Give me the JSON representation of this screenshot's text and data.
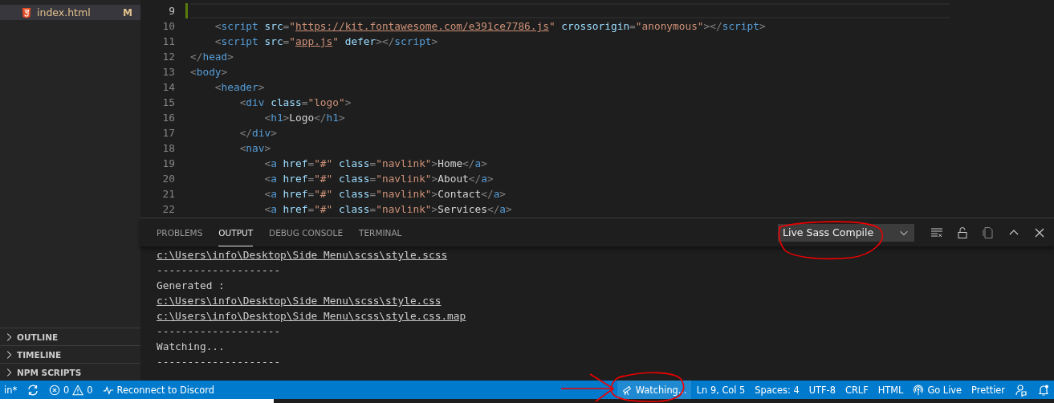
{
  "sidebar": {
    "files": [
      {
        "name": "index.html",
        "badge": "M",
        "selected": true
      }
    ],
    "sections": [
      {
        "label": "OUTLINE",
        "expanded": false
      },
      {
        "label": "TIMELINE",
        "expanded": false
      },
      {
        "label": "NPM SCRIPTS",
        "expanded": false
      }
    ]
  },
  "editor": {
    "lines": [
      {
        "number": "9",
        "current": true,
        "modified": true
      },
      {
        "number": "10",
        "current": false,
        "modified": false,
        "tokens": [
          {
            "kind": "punct",
            "text": "    <"
          },
          {
            "kind": "tag",
            "text": "script"
          },
          {
            "kind": "attr",
            "text": " src"
          },
          {
            "kind": "punct",
            "text": "="
          },
          {
            "kind": "string",
            "text": "\""
          },
          {
            "kind": "link",
            "text": "https://kit.fontawesome.com/e391ce7786.js"
          },
          {
            "kind": "string",
            "text": "\""
          },
          {
            "kind": "attr",
            "text": " crossorigin"
          },
          {
            "kind": "punct",
            "text": "="
          },
          {
            "kind": "string",
            "text": "\"anonymous\""
          },
          {
            "kind": "punct",
            "text": "></"
          },
          {
            "kind": "tag",
            "text": "script"
          },
          {
            "kind": "punct",
            "text": ">"
          }
        ]
      },
      {
        "number": "11",
        "current": false,
        "modified": false,
        "tokens": [
          {
            "kind": "punct",
            "text": "    <"
          },
          {
            "kind": "tag",
            "text": "script"
          },
          {
            "kind": "attr",
            "text": " src"
          },
          {
            "kind": "punct",
            "text": "="
          },
          {
            "kind": "string",
            "text": "\""
          },
          {
            "kind": "link",
            "text": "app.js"
          },
          {
            "kind": "string",
            "text": "\""
          },
          {
            "kind": "attr",
            "text": " defer"
          },
          {
            "kind": "punct",
            "text": "></"
          },
          {
            "kind": "tag",
            "text": "script"
          },
          {
            "kind": "punct",
            "text": ">"
          }
        ]
      },
      {
        "number": "12",
        "current": false,
        "modified": false,
        "tokens": [
          {
            "kind": "punct",
            "text": "</"
          },
          {
            "kind": "tag",
            "text": "head"
          },
          {
            "kind": "punct",
            "text": ">"
          }
        ]
      },
      {
        "number": "13",
        "current": false,
        "modified": false,
        "tokens": [
          {
            "kind": "punct",
            "text": "<"
          },
          {
            "kind": "tag",
            "text": "body"
          },
          {
            "kind": "punct",
            "text": ">"
          }
        ]
      },
      {
        "number": "14",
        "current": false,
        "modified": false,
        "tokens": [
          {
            "kind": "punct",
            "text": "    <"
          },
          {
            "kind": "tag",
            "text": "header"
          },
          {
            "kind": "punct",
            "text": ">"
          }
        ]
      },
      {
        "number": "15",
        "current": false,
        "modified": false,
        "tokens": [
          {
            "kind": "punct",
            "text": "        <"
          },
          {
            "kind": "tag",
            "text": "div"
          },
          {
            "kind": "attr",
            "text": " class"
          },
          {
            "kind": "punct",
            "text": "="
          },
          {
            "kind": "string",
            "text": "\"logo\""
          },
          {
            "kind": "punct",
            "text": ">"
          }
        ]
      },
      {
        "number": "16",
        "current": false,
        "modified": false,
        "tokens": [
          {
            "kind": "punct",
            "text": "            <"
          },
          {
            "kind": "tag",
            "text": "h1"
          },
          {
            "kind": "punct",
            "text": ">"
          },
          {
            "kind": "text",
            "text": "Logo"
          },
          {
            "kind": "punct",
            "text": "</"
          },
          {
            "kind": "tag",
            "text": "h1"
          },
          {
            "kind": "punct",
            "text": ">"
          }
        ]
      },
      {
        "number": "17",
        "current": false,
        "modified": false,
        "tokens": [
          {
            "kind": "punct",
            "text": "        </"
          },
          {
            "kind": "tag",
            "text": "div"
          },
          {
            "kind": "punct",
            "text": ">"
          }
        ]
      },
      {
        "number": "18",
        "current": false,
        "modified": false,
        "tokens": [
          {
            "kind": "punct",
            "text": "        <"
          },
          {
            "kind": "tag",
            "text": "nav"
          },
          {
            "kind": "punct",
            "text": ">"
          }
        ]
      },
      {
        "number": "19",
        "current": false,
        "modified": false,
        "tokens": [
          {
            "kind": "punct",
            "text": "            <"
          },
          {
            "kind": "tag",
            "text": "a"
          },
          {
            "kind": "attr",
            "text": " href"
          },
          {
            "kind": "punct",
            "text": "="
          },
          {
            "kind": "string",
            "text": "\"#\""
          },
          {
            "kind": "attr",
            "text": " class"
          },
          {
            "kind": "punct",
            "text": "="
          },
          {
            "kind": "string",
            "text": "\"navlink\""
          },
          {
            "kind": "punct",
            "text": ">"
          },
          {
            "kind": "text",
            "text": "Home"
          },
          {
            "kind": "punct",
            "text": "</"
          },
          {
            "kind": "tag",
            "text": "a"
          },
          {
            "kind": "punct",
            "text": ">"
          }
        ]
      },
      {
        "number": "20",
        "current": false,
        "modified": false,
        "tokens": [
          {
            "kind": "punct",
            "text": "            <"
          },
          {
            "kind": "tag",
            "text": "a"
          },
          {
            "kind": "attr",
            "text": " href"
          },
          {
            "kind": "punct",
            "text": "="
          },
          {
            "kind": "string",
            "text": "\"#\""
          },
          {
            "kind": "attr",
            "text": " class"
          },
          {
            "kind": "punct",
            "text": "="
          },
          {
            "kind": "string",
            "text": "\"navlink\""
          },
          {
            "kind": "punct",
            "text": ">"
          },
          {
            "kind": "text",
            "text": "About"
          },
          {
            "kind": "punct",
            "text": "</"
          },
          {
            "kind": "tag",
            "text": "a"
          },
          {
            "kind": "punct",
            "text": ">"
          }
        ]
      },
      {
        "number": "21",
        "current": false,
        "modified": false,
        "tokens": [
          {
            "kind": "punct",
            "text": "            <"
          },
          {
            "kind": "tag",
            "text": "a"
          },
          {
            "kind": "attr",
            "text": " href"
          },
          {
            "kind": "punct",
            "text": "="
          },
          {
            "kind": "string",
            "text": "\"#\""
          },
          {
            "kind": "attr",
            "text": " class"
          },
          {
            "kind": "punct",
            "text": "="
          },
          {
            "kind": "string",
            "text": "\"navlink\""
          },
          {
            "kind": "punct",
            "text": ">"
          },
          {
            "kind": "text",
            "text": "Contact"
          },
          {
            "kind": "punct",
            "text": "</"
          },
          {
            "kind": "tag",
            "text": "a"
          },
          {
            "kind": "punct",
            "text": ">"
          }
        ]
      },
      {
        "number": "22",
        "current": false,
        "modified": false,
        "tokens": [
          {
            "kind": "punct",
            "text": "            <"
          },
          {
            "kind": "tag",
            "text": "a"
          },
          {
            "kind": "attr",
            "text": " href"
          },
          {
            "kind": "punct",
            "text": "="
          },
          {
            "kind": "string",
            "text": "\"#\""
          },
          {
            "kind": "attr",
            "text": " class"
          },
          {
            "kind": "punct",
            "text": "="
          },
          {
            "kind": "string",
            "text": "\"navlink\""
          },
          {
            "kind": "punct",
            "text": ">"
          },
          {
            "kind": "text",
            "text": "Services"
          },
          {
            "kind": "punct",
            "text": "</"
          },
          {
            "kind": "tag",
            "text": "a"
          },
          {
            "kind": "punct",
            "text": ">"
          }
        ]
      }
    ]
  },
  "panel": {
    "tabs": [
      {
        "label": "PROBLEMS",
        "selected": false
      },
      {
        "label": "OUTPUT",
        "selected": true
      },
      {
        "label": "DEBUG CONSOLE",
        "selected": false
      },
      {
        "label": "TERMINAL",
        "selected": false
      }
    ],
    "channel": "Live Sass Compile",
    "output": [
      {
        "kind": "link",
        "text": "c:\\Users\\info\\Desktop\\Side Menu\\scss\\style.scss"
      },
      {
        "kind": "text",
        "text": "--------------------"
      },
      {
        "kind": "text",
        "text": "Generated :"
      },
      {
        "kind": "link",
        "text": "c:\\Users\\info\\Desktop\\Side Menu\\scss\\style.css"
      },
      {
        "kind": "link",
        "text": "c:\\Users\\info\\Desktop\\Side Menu\\scss\\style.css.map"
      },
      {
        "kind": "text",
        "text": "--------------------"
      },
      {
        "kind": "text",
        "text": "Watching..."
      },
      {
        "kind": "text",
        "text": "--------------------"
      }
    ]
  },
  "status_bar": {
    "left": [
      {
        "kind": "branch",
        "text": "in*"
      },
      {
        "kind": "sync"
      },
      {
        "kind": "problems",
        "errors": "0",
        "warnings": "0"
      },
      {
        "kind": "discord",
        "text": "Reconnect to Discord"
      }
    ],
    "right": [
      {
        "kind": "watch",
        "text": "Watching...",
        "highlighted": true
      },
      {
        "kind": "plain",
        "text": "Ln 9, Col 5"
      },
      {
        "kind": "plain",
        "text": "Spaces: 4"
      },
      {
        "kind": "plain",
        "text": "UTF-8"
      },
      {
        "kind": "plain",
        "text": "CRLF"
      },
      {
        "kind": "plain",
        "text": "HTML"
      },
      {
        "kind": "golive",
        "text": "Go Live"
      },
      {
        "kind": "plain",
        "text": "Prettier"
      },
      {
        "kind": "feedback"
      },
      {
        "kind": "bell"
      }
    ]
  }
}
